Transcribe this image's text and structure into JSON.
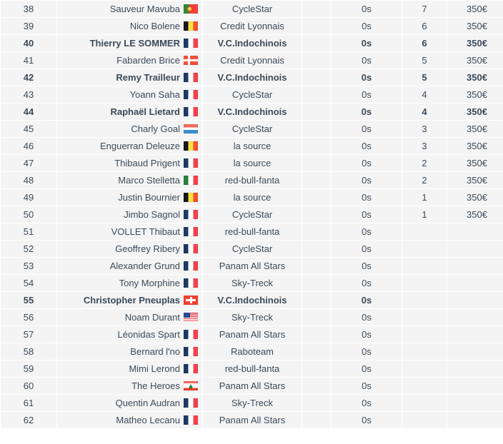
{
  "table": {
    "colors": {
      "row_background": "#f4f4f4",
      "page_background": "#ffffff",
      "name_text": "#9ccb3b",
      "team_text": "#9ccb3b",
      "numeric_text": "#3a4a5a",
      "highlight_text": "#00a100"
    },
    "rows": [
      {
        "rank": "38",
        "name": "Sauveur Mavuba",
        "flag": "pt",
        "team": "CycleStar",
        "time": "0s",
        "points": "7",
        "money": "350€",
        "highlight": false
      },
      {
        "rank": "39",
        "name": "Nico Bolene",
        "flag": "be",
        "team": "Credit Lyonnais",
        "time": "0s",
        "points": "6",
        "money": "350€",
        "highlight": false
      },
      {
        "rank": "40",
        "name": "Thierry LE SOMMER",
        "flag": "fr",
        "team": "V.C.Indochinois",
        "time": "0s",
        "points": "6",
        "money": "350€",
        "highlight": true
      },
      {
        "rank": "41",
        "name": "Fabarden Brice",
        "flag": "dk",
        "team": "Credit Lyonnais",
        "time": "0s",
        "points": "5",
        "money": "350€",
        "highlight": false
      },
      {
        "rank": "42",
        "name": "Remy Trailleur",
        "flag": "fr",
        "team": "V.C.Indochinois",
        "time": "0s",
        "points": "5",
        "money": "350€",
        "highlight": true
      },
      {
        "rank": "43",
        "name": "Yoann Saha",
        "flag": "fr",
        "team": "CycleStar",
        "time": "0s",
        "points": "4",
        "money": "350€",
        "highlight": false
      },
      {
        "rank": "44",
        "name": "Raphaël Lietard",
        "flag": "fr",
        "team": "V.C.Indochinois",
        "time": "0s",
        "points": "4",
        "money": "350€",
        "highlight": true
      },
      {
        "rank": "45",
        "name": "Charly Goal",
        "flag": "nl",
        "team": "CycleStar",
        "time": "0s",
        "points": "3",
        "money": "350€",
        "highlight": false
      },
      {
        "rank": "46",
        "name": "Enguerran Deleuze",
        "flag": "be",
        "team": "la source",
        "time": "0s",
        "points": "3",
        "money": "350€",
        "highlight": false
      },
      {
        "rank": "47",
        "name": "Thibaud Prigent",
        "flag": "fr",
        "team": "la source",
        "time": "0s",
        "points": "2",
        "money": "350€",
        "highlight": false
      },
      {
        "rank": "48",
        "name": "Marco Stelletta",
        "flag": "it",
        "team": "red-bull-fanta",
        "time": "0s",
        "points": "2",
        "money": "350€",
        "highlight": false
      },
      {
        "rank": "49",
        "name": "Justin Bournier",
        "flag": "be",
        "team": "la source",
        "time": "0s",
        "points": "1",
        "money": "350€",
        "highlight": false
      },
      {
        "rank": "50",
        "name": "Jimbo Sagnol",
        "flag": "fr",
        "team": "CycleStar",
        "time": "0s",
        "points": "1",
        "money": "350€",
        "highlight": false
      },
      {
        "rank": "51",
        "name": "VOLLET Thibaut",
        "flag": "fr",
        "team": "red-bull-fanta",
        "time": "0s",
        "points": "",
        "money": "",
        "highlight": false
      },
      {
        "rank": "52",
        "name": "Geoffrey Ribery",
        "flag": "fr",
        "team": "CycleStar",
        "time": "0s",
        "points": "",
        "money": "",
        "highlight": false
      },
      {
        "rank": "53",
        "name": "Alexander Grund",
        "flag": "fr",
        "team": "Panam All Stars",
        "time": "0s",
        "points": "",
        "money": "",
        "highlight": false
      },
      {
        "rank": "54",
        "name": "Tony Morphine",
        "flag": "fr",
        "team": "Sky-Treck",
        "time": "0s",
        "points": "",
        "money": "",
        "highlight": false
      },
      {
        "rank": "55",
        "name": "Christopher Pneuplas",
        "flag": "ch",
        "team": "V.C.Indochinois",
        "time": "0s",
        "points": "",
        "money": "",
        "highlight": true
      },
      {
        "rank": "56",
        "name": "Noam Durant",
        "flag": "us",
        "team": "Sky-Treck",
        "time": "0s",
        "points": "",
        "money": "",
        "highlight": false
      },
      {
        "rank": "57",
        "name": "Léonidas Spart",
        "flag": "fr",
        "team": "Panam All Stars",
        "time": "0s",
        "points": "",
        "money": "",
        "highlight": false
      },
      {
        "rank": "58",
        "name": "Bernard l'no",
        "flag": "fr",
        "team": "Raboteam",
        "time": "0s",
        "points": "",
        "money": "",
        "highlight": false
      },
      {
        "rank": "59",
        "name": "Mimi Lerond",
        "flag": "fr",
        "team": "red-bull-fanta",
        "time": "0s",
        "points": "",
        "money": "",
        "highlight": false
      },
      {
        "rank": "60",
        "name": "The Heroes",
        "flag": "lb",
        "team": "Panam All Stars",
        "time": "0s",
        "points": "",
        "money": "",
        "highlight": false
      },
      {
        "rank": "61",
        "name": "Quentin Audran",
        "flag": "fr",
        "team": "Sky-Treck",
        "time": "0s",
        "points": "",
        "money": "",
        "highlight": false
      },
      {
        "rank": "62",
        "name": "Matheo Lecanu",
        "flag": "fr",
        "team": "Panam All Stars",
        "time": "0s",
        "points": "",
        "money": "",
        "highlight": false
      }
    ]
  }
}
